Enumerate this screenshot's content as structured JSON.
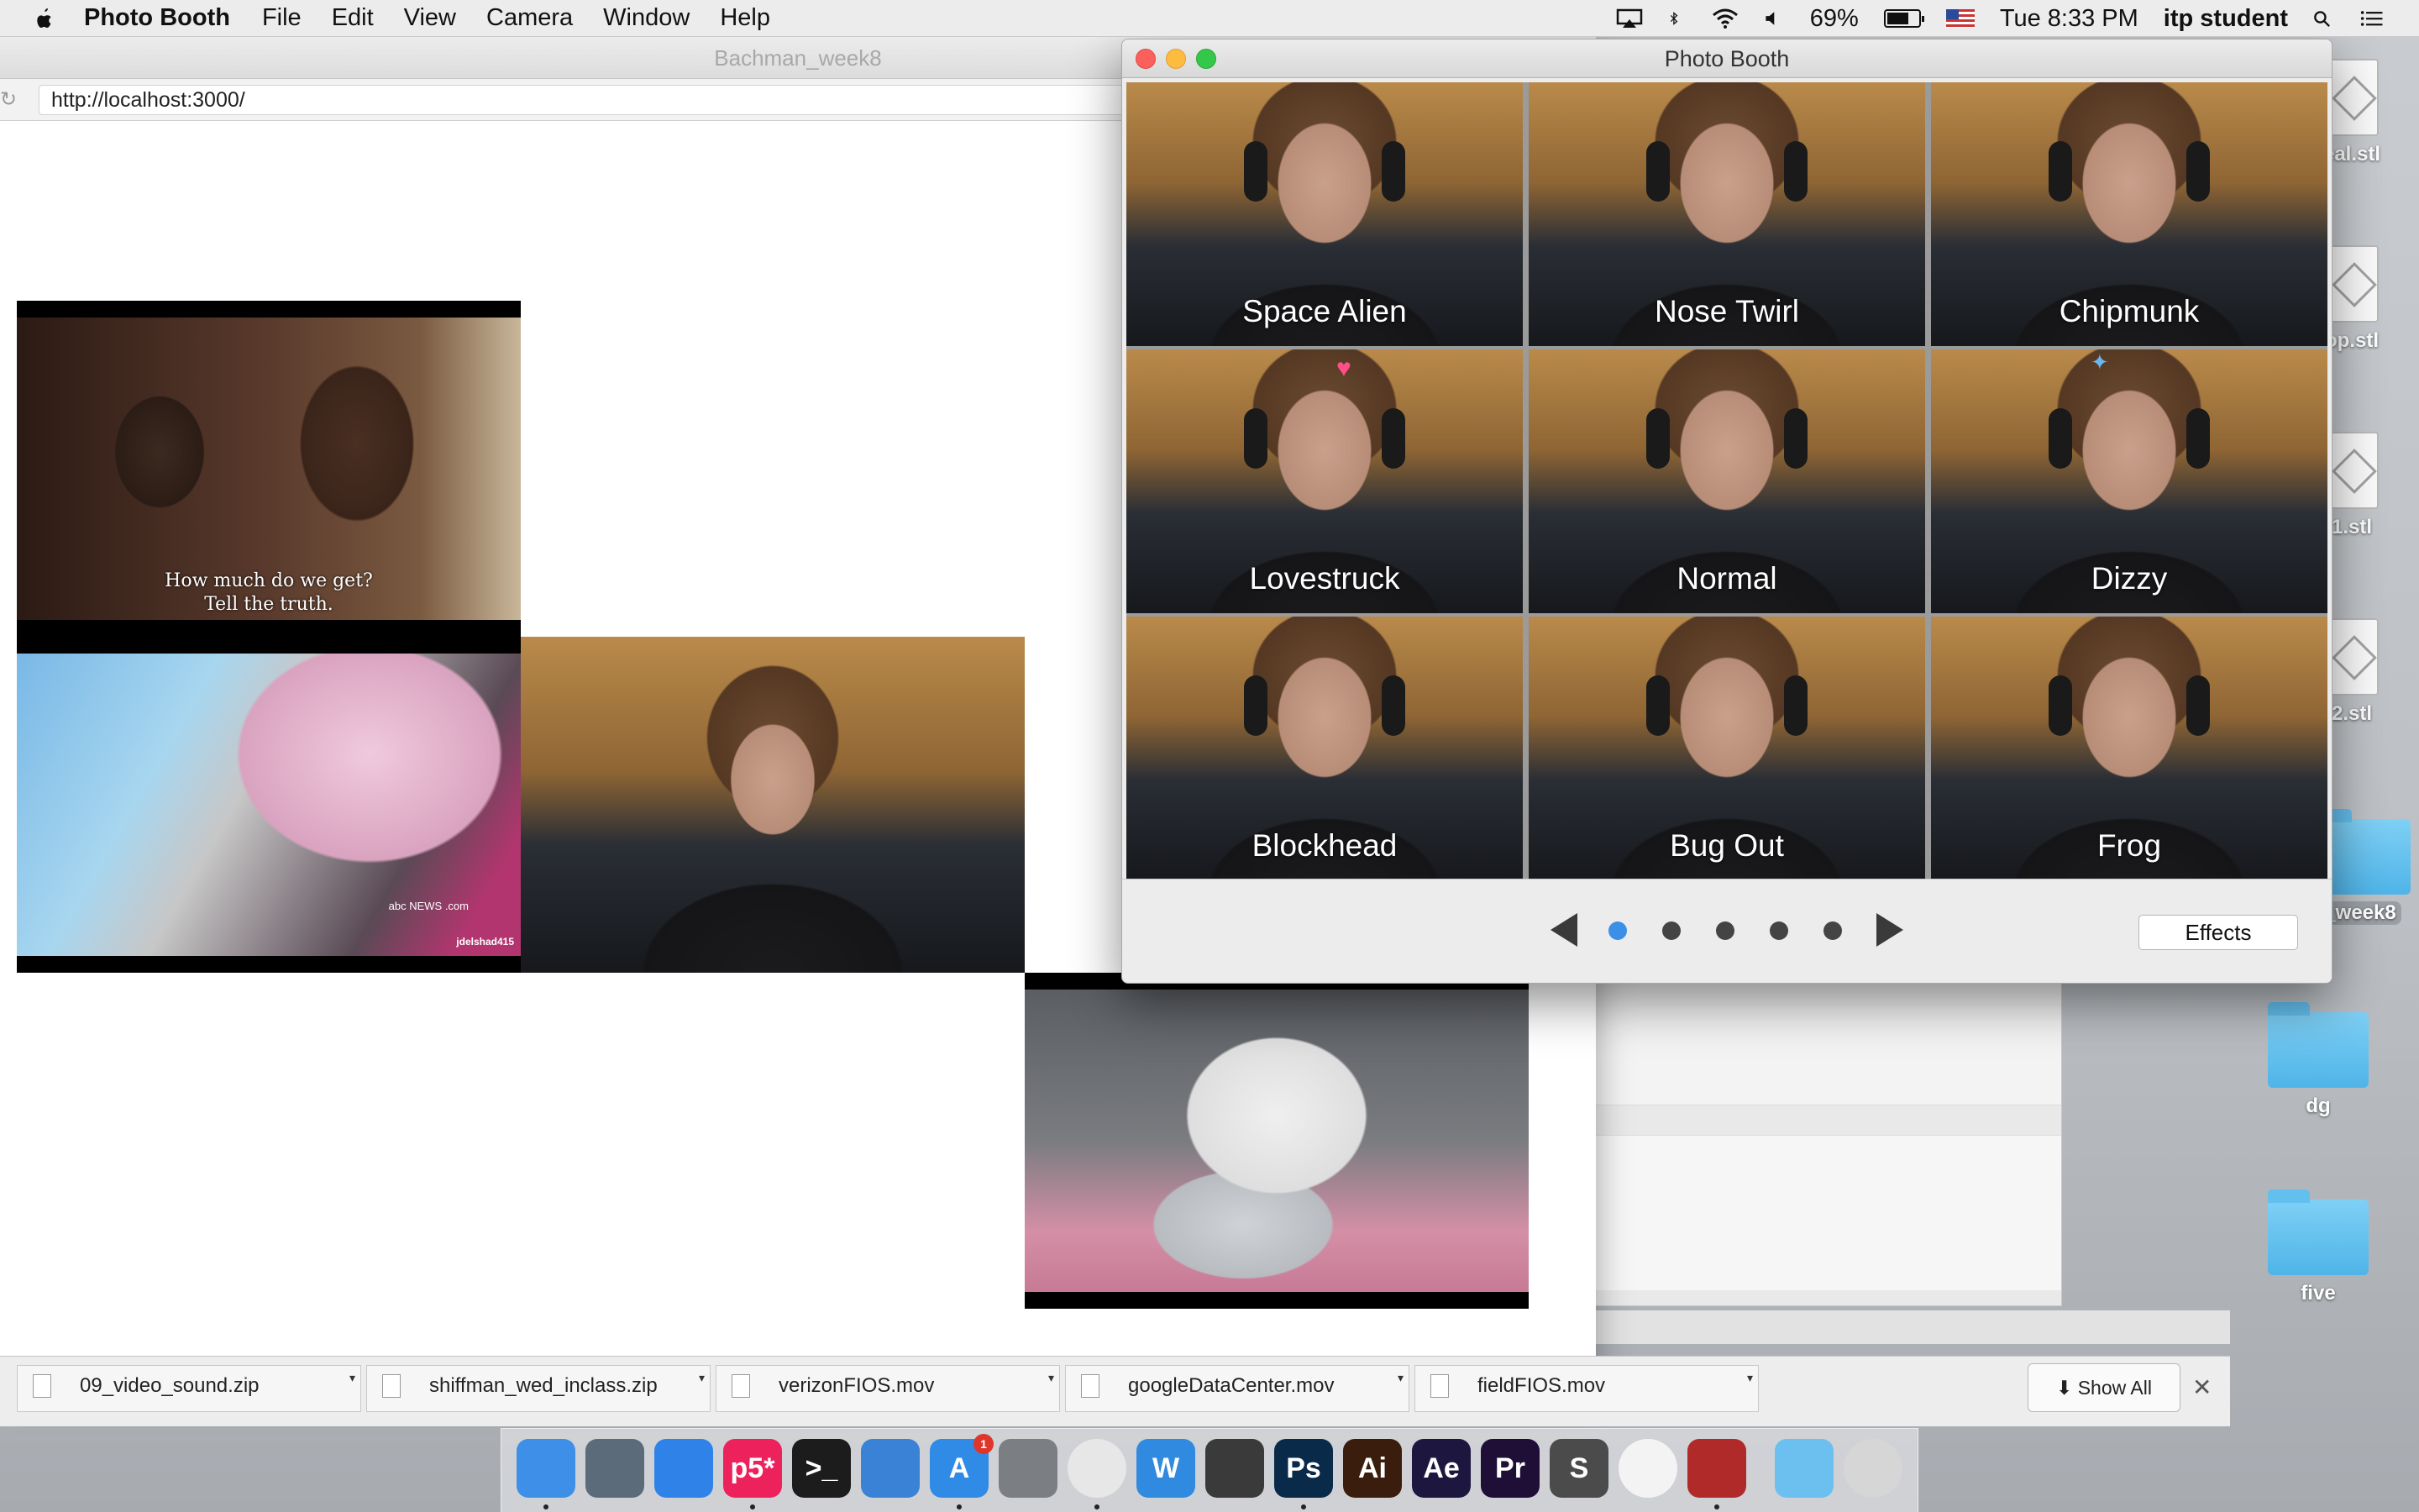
{
  "menubar": {
    "app_name": "Photo Booth",
    "menus": [
      "File",
      "Edit",
      "View",
      "Camera",
      "Window",
      "Help"
    ],
    "battery_percent": "69%",
    "battery_level": 0.69,
    "clock": "Tue 8:33 PM",
    "user": "itp student",
    "icons": [
      "apple-icon",
      "airplay-icon",
      "bluetooth-icon",
      "wifi-icon",
      "volume-icon",
      "battery-icon",
      "flag-icon",
      "spotlight-icon",
      "notification-center-icon"
    ]
  },
  "browser": {
    "title": "Bachman_week8",
    "url": "http://localhost:3000/",
    "videos": {
      "subtitle_line1": "How much do we get?",
      "subtitle_line2": "Tell the truth.",
      "watermark_news": "abc NEWS .com",
      "watermark_user": "jdelshad415"
    }
  },
  "downloads": {
    "items": [
      "09_video_sound.zip",
      "shiffman_wed_inclass.zip",
      "verizonFIOS.mov",
      "googleDataCenter.mov",
      "fieldFIOS.mov"
    ],
    "show_all": "Show All",
    "close": "✕"
  },
  "desktop": {
    "icons": [
      {
        "label": "eal.stl",
        "kind": "doc"
      },
      {
        "label": "op.stl",
        "kind": "doc"
      },
      {
        "label": "1.stl",
        "kind": "doc"
      },
      {
        "label": "2.stl",
        "kind": "doc"
      },
      {
        "label": "_week8",
        "kind": "folder"
      },
      {
        "label": "dg",
        "kind": "folder"
      },
      {
        "label": "five",
        "kind": "folder"
      }
    ]
  },
  "photobooth": {
    "title": "Photo Booth",
    "effects": [
      "Space Alien",
      "Nose Twirl",
      "Chipmunk",
      "Lovestruck",
      "Normal",
      "Dizzy",
      "Blockhead",
      "Bug Out",
      "Frog"
    ],
    "effects_button": "Effects",
    "page_count": 5,
    "active_page": 1
  },
  "dock": {
    "apps": [
      {
        "name": "finder-icon",
        "label": "",
        "color": "#3d8fe8"
      },
      {
        "name": "launchpad-icon",
        "label": "",
        "color": "#5b6b7a"
      },
      {
        "name": "safari-icon",
        "label": "",
        "color": "#2f83e8"
      },
      {
        "name": "p5-icon",
        "label": "p5*",
        "color": "#ed225d"
      },
      {
        "name": "terminal-icon",
        "label": ">_",
        "color": "#1c1c1c"
      },
      {
        "name": "xcode-icon",
        "label": "",
        "color": "#3a82d6"
      },
      {
        "name": "app-store-icon",
        "label": "A",
        "color": "#2f8be6",
        "badge": "1"
      },
      {
        "name": "system-preferences-icon",
        "label": "",
        "color": "#7b7f84"
      },
      {
        "name": "chrome-icon",
        "label": "",
        "color": "#e7e7e7"
      },
      {
        "name": "word-icon",
        "label": "W",
        "color": "#2f8ae0"
      },
      {
        "name": "scrivener-icon",
        "label": "",
        "color": "#3a3a3a"
      },
      {
        "name": "photoshop-icon",
        "label": "Ps",
        "color": "#0a2a4a"
      },
      {
        "name": "illustrator-icon",
        "label": "Ai",
        "color": "#3a1d0c"
      },
      {
        "name": "after-effects-icon",
        "label": "Ae",
        "color": "#1d1740"
      },
      {
        "name": "premiere-icon",
        "label": "Pr",
        "color": "#1f0f36"
      },
      {
        "name": "sublime-text-icon",
        "label": "S",
        "color": "#4b4b4b"
      },
      {
        "name": "photos-icon",
        "label": "",
        "color": "#f3f3f3"
      },
      {
        "name": "photo-booth-icon",
        "label": "",
        "color": "#b12a2a"
      },
      {
        "name": "downloads-folder-icon",
        "label": "",
        "color": "#6cc0f0"
      },
      {
        "name": "trash-icon",
        "label": "",
        "color": "#d6d6d6"
      }
    ]
  }
}
